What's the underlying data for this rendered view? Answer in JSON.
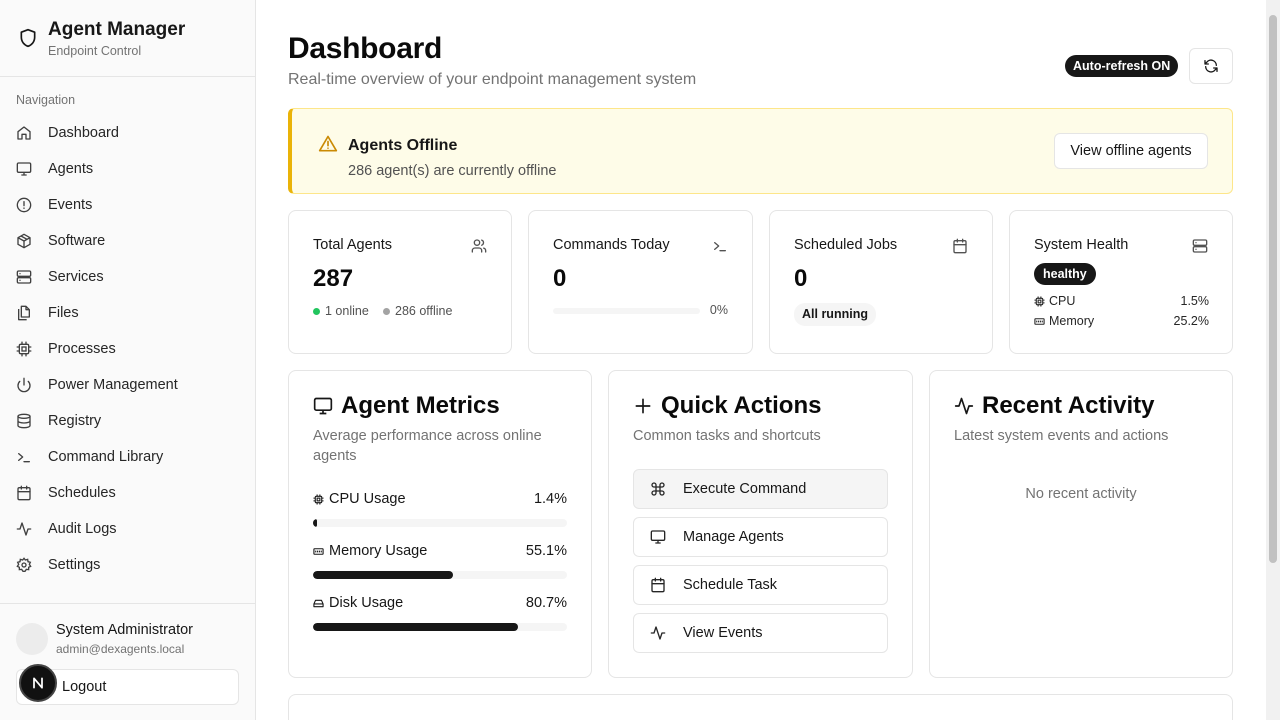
{
  "app": {
    "title": "Agent Manager",
    "subtitle": "Endpoint Control"
  },
  "sidebar": {
    "heading": "Navigation",
    "items": [
      {
        "label": "Dashboard",
        "icon": "home-icon"
      },
      {
        "label": "Agents",
        "icon": "monitor-icon"
      },
      {
        "label": "Events",
        "icon": "alert-circle-icon"
      },
      {
        "label": "Software",
        "icon": "package-icon"
      },
      {
        "label": "Services",
        "icon": "server-icon"
      },
      {
        "label": "Files",
        "icon": "files-icon"
      },
      {
        "label": "Processes",
        "icon": "cpu-icon"
      },
      {
        "label": "Power Management",
        "icon": "power-icon"
      },
      {
        "label": "Registry",
        "icon": "database-icon"
      },
      {
        "label": "Command Library",
        "icon": "terminal-icon"
      },
      {
        "label": "Schedules",
        "icon": "calendar-icon"
      },
      {
        "label": "Audit Logs",
        "icon": "activity-icon"
      },
      {
        "label": "Settings",
        "icon": "gear-icon"
      }
    ],
    "user": {
      "name": "System Administrator",
      "email": "admin@dexagents.local"
    },
    "logout_label": "Logout",
    "n_badge": "N"
  },
  "header": {
    "title": "Dashboard",
    "subtitle": "Real-time overview of your endpoint management system",
    "autorefresh_label": "Auto-refresh ON"
  },
  "alert": {
    "title": "Agents Offline",
    "message": "286 agent(s) are currently offline",
    "button_label": "View offline agents",
    "color": "#eab308"
  },
  "stats": {
    "total_agents": {
      "label": "Total Agents",
      "value": "287",
      "online": "1 online",
      "offline": "286 offline"
    },
    "commands_today": {
      "label": "Commands Today",
      "value": "0",
      "percent": "0%",
      "progress": 0
    },
    "scheduled_jobs": {
      "label": "Scheduled Jobs",
      "value": "0",
      "status": "All running"
    },
    "system_health": {
      "label": "System Health",
      "status": "healthy",
      "cpu_label": "CPU",
      "cpu_value": "1.5%",
      "memory_label": "Memory",
      "memory_value": "25.2%"
    }
  },
  "agent_metrics": {
    "title": "Agent Metrics",
    "subtitle": "Average performance across online agents",
    "metrics": [
      {
        "label": "CPU Usage",
        "value_text": "1.4%",
        "value": 1.4
      },
      {
        "label": "Memory Usage",
        "value_text": "55.1%",
        "value": 55.1
      },
      {
        "label": "Disk Usage",
        "value_text": "80.7%",
        "value": 80.7
      }
    ]
  },
  "quick_actions": {
    "title": "Quick Actions",
    "subtitle": "Common tasks and shortcuts",
    "actions": [
      {
        "label": "Execute Command",
        "icon": "command-icon"
      },
      {
        "label": "Manage Agents",
        "icon": "monitor-icon"
      },
      {
        "label": "Schedule Task",
        "icon": "calendar-icon"
      },
      {
        "label": "View Events",
        "icon": "activity-icon"
      }
    ]
  },
  "recent_activity": {
    "title": "Recent Activity",
    "subtitle": "Latest system events and actions",
    "empty_text": "No recent activity"
  },
  "colors": {
    "online": "#22c55e",
    "offline": "#a3a3a3",
    "accent": "#171717",
    "alert_bg": "#fefce8"
  }
}
